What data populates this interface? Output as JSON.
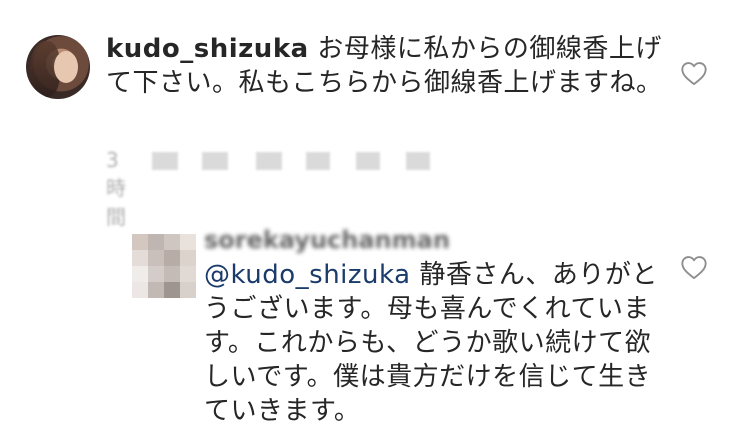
{
  "main_comment": {
    "username": "kudo_shizuka",
    "text": "お母様に私からの御線香上げて下さい。私もこちらから御線香上げますね。",
    "time": "3時間"
  },
  "reply": {
    "username": "sorekayuchanman",
    "mention": "@kudo_shizuka",
    "text": "静香さん、ありがとうございます。母も喜んでくれています。これからも、どうか歌い続けて欲しいです。僕は貴方だけを信じて生きていきます。"
  },
  "icons": {
    "like": "heart-outline-icon"
  },
  "colors": {
    "text": "#262626",
    "meta": "#8e8e8e",
    "mention": "#1a3b6b"
  }
}
